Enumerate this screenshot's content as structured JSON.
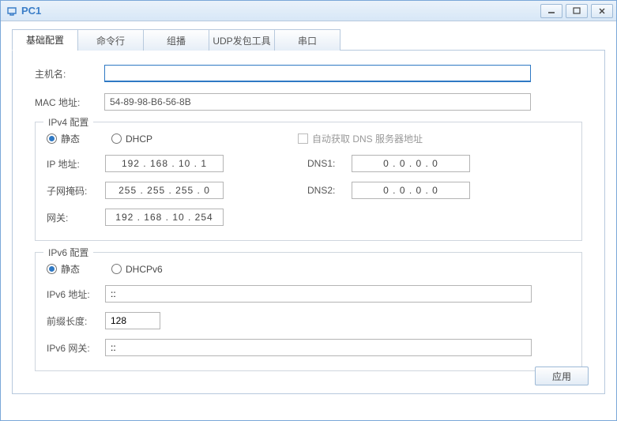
{
  "window": {
    "title": "PC1"
  },
  "tabs": [
    {
      "label": "基础配置"
    },
    {
      "label": "命令行"
    },
    {
      "label": "组播"
    },
    {
      "label": "UDP发包工具"
    },
    {
      "label": "串口"
    }
  ],
  "basic": {
    "hostname_label": "主机名:",
    "hostname_value": "",
    "mac_label": "MAC 地址:",
    "mac_value": "54-89-98-B6-56-8B"
  },
  "ipv4": {
    "legend": "IPv4 配置",
    "static_label": "静态",
    "dhcp_label": "DHCP",
    "autodns_label": "自动获取 DNS 服务器地址",
    "ip_label": "IP 地址:",
    "ip_value": "192  .  168  .  10   .   1",
    "mask_label": "子网掩码:",
    "mask_value": "255  .  255  .  255  .   0",
    "gw_label": "网关:",
    "gw_value": "192  .  168  .  10  .  254",
    "dns1_label": "DNS1:",
    "dns1_value": "0   .   0   .   0   .   0",
    "dns2_label": "DNS2:",
    "dns2_value": "0   .   0   .   0   .   0"
  },
  "ipv6": {
    "legend": "IPv6 配置",
    "static_label": "静态",
    "dhcp_label": "DHCPv6",
    "addr_label": "IPv6 地址:",
    "addr_value": "::",
    "prefix_label": "前缀长度:",
    "prefix_value": "128",
    "gw_label": "IPv6 网关:",
    "gw_value": "::"
  },
  "buttons": {
    "apply": "应用"
  }
}
